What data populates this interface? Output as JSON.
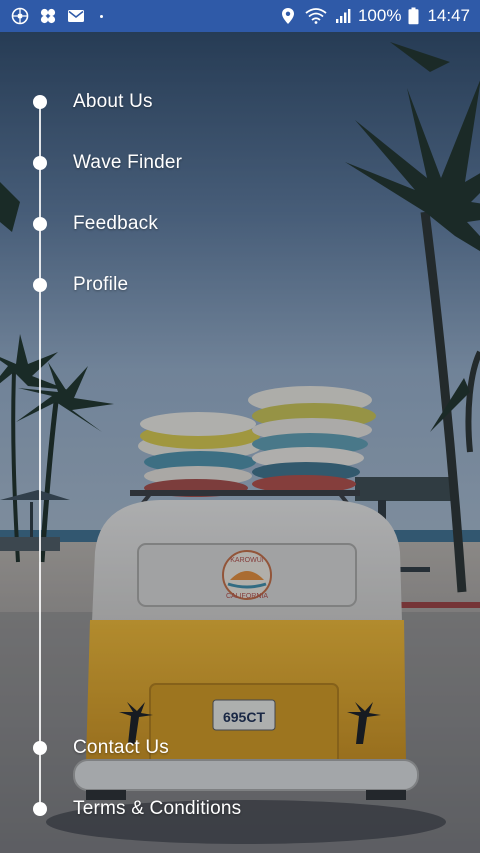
{
  "status_bar": {
    "battery": "100%",
    "time": "14:47",
    "left_icons": [
      "soccer-ball-icon",
      "clover-icon",
      "mail-icon"
    ],
    "right_icons": [
      "location-icon",
      "wifi-icon",
      "signal-icon",
      "battery-icon"
    ]
  },
  "background": {
    "description_icon": "surf-van-photo",
    "plate": "695CT",
    "van_badge_top": "KAROWUI",
    "van_badge_bottom": "CALIFORNIA"
  },
  "menu": {
    "items": [
      {
        "label": "About Us"
      },
      {
        "label": "Wave Finder"
      },
      {
        "label": "Feedback"
      },
      {
        "label": "Profile"
      },
      {
        "label": "Contact Us"
      },
      {
        "label": "Terms & Conditions"
      }
    ]
  },
  "colors": {
    "status_bar": "#2f5aa8",
    "van_yellow": "#e3a21f",
    "menu_text": "#ffffff"
  }
}
